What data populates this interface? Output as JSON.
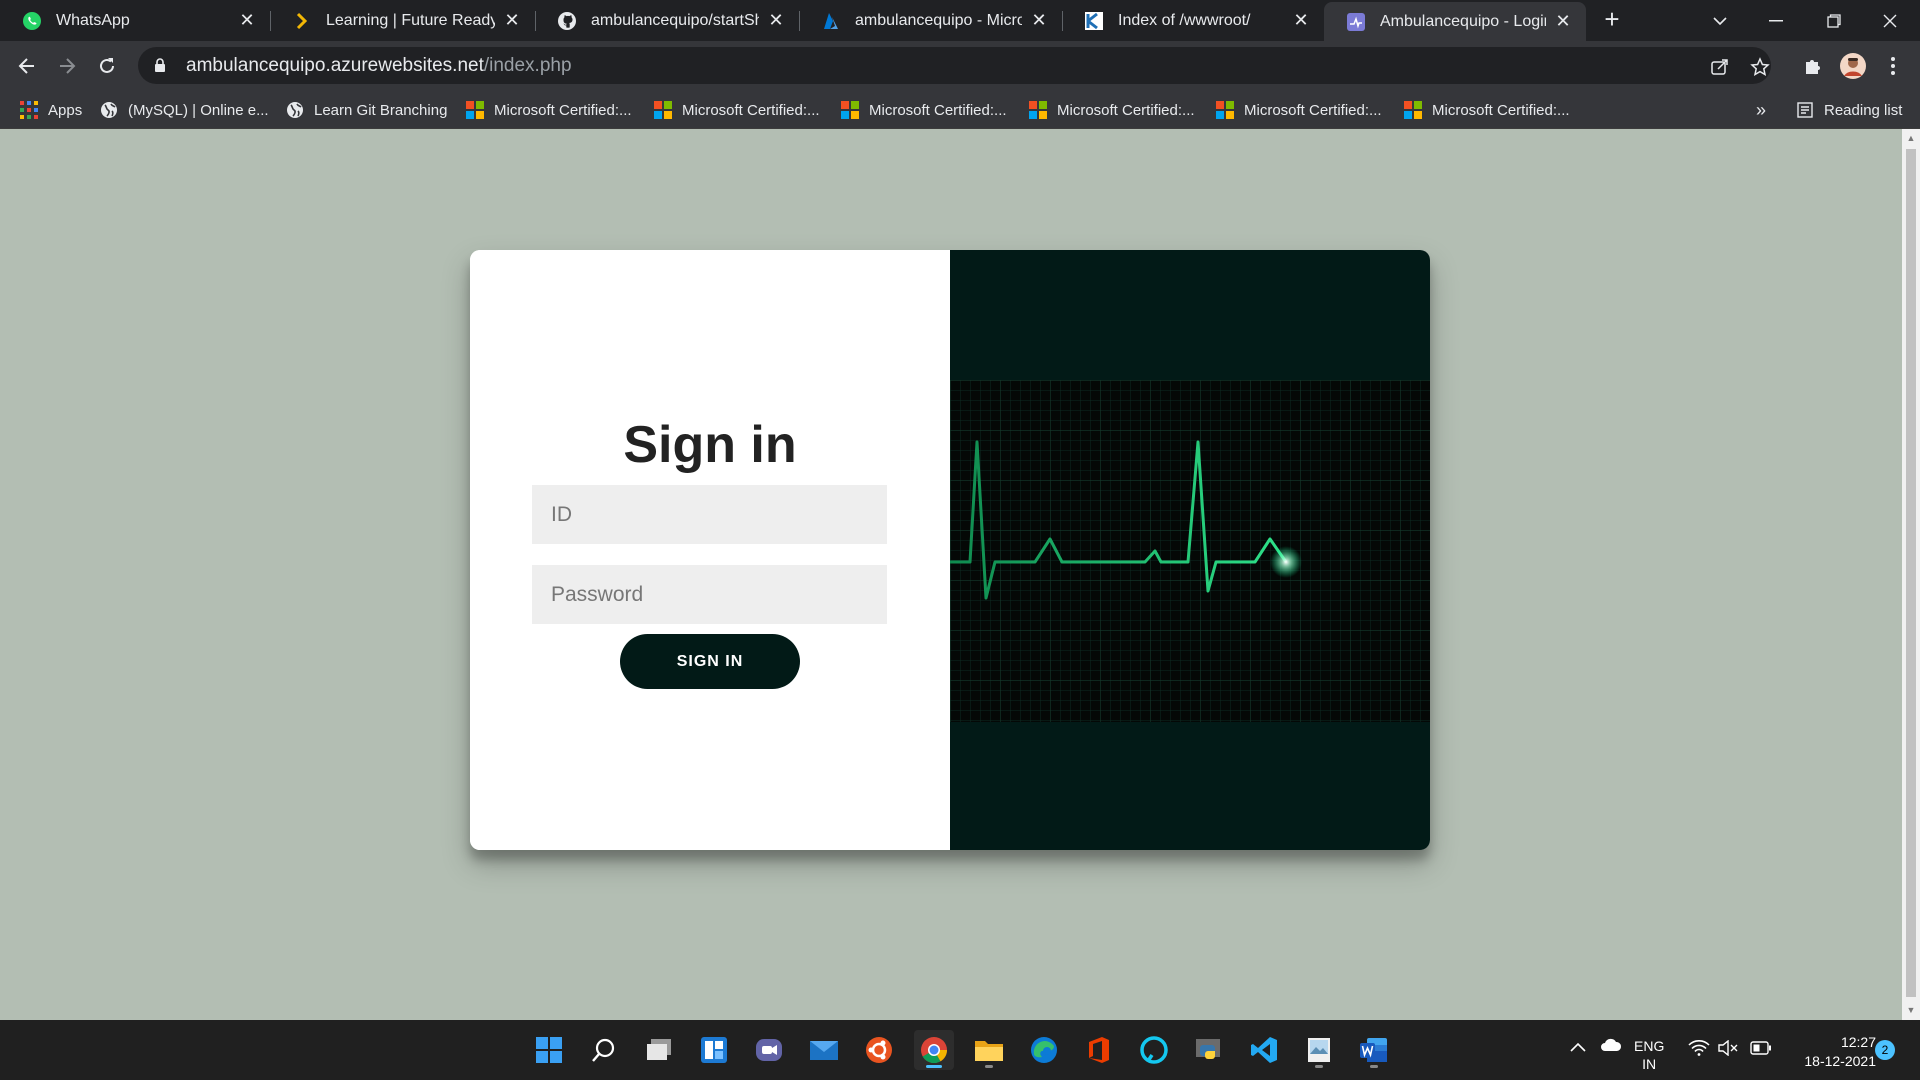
{
  "browser": {
    "tabs": [
      {
        "title": "WhatsApp",
        "icon": "whatsapp-icon"
      },
      {
        "title": "Learning | Future Ready Talent",
        "icon": "learning-icon"
      },
      {
        "title": "ambulancequipo/startSharing",
        "icon": "github-icon"
      },
      {
        "title": "ambulancequipo - Microsoft Azure",
        "icon": "azure-icon"
      },
      {
        "title": "Index of /wwwroot/",
        "icon": "kudu-icon"
      },
      {
        "title": "Ambulancequipo - Login",
        "icon": "site-icon",
        "active": true
      }
    ],
    "url": {
      "host": "ambulancequipo.azurewebsites.net",
      "path": "/index.php"
    },
    "bookmarks": [
      {
        "label": "Apps",
        "icon": "apps-grid-icon"
      },
      {
        "label": "(MySQL) | Online e...",
        "icon": "globe-icon"
      },
      {
        "label": "Learn Git Branching",
        "icon": "globe-icon"
      },
      {
        "label": "Microsoft Certified:...",
        "icon": "microsoft-logo-icon"
      },
      {
        "label": "Microsoft Certified:...",
        "icon": "microsoft-logo-icon"
      },
      {
        "label": "Microsoft Certified:...",
        "icon": "microsoft-logo-icon"
      },
      {
        "label": "Microsoft Certified:...",
        "icon": "microsoft-logo-icon"
      },
      {
        "label": "Microsoft Certified:...",
        "icon": "microsoft-logo-icon"
      },
      {
        "label": "Microsoft Certified:...",
        "icon": "microsoft-logo-icon"
      }
    ],
    "overflow_label": "»",
    "reading_list_label": "Reading list"
  },
  "login": {
    "heading": "Sign in",
    "id_placeholder": "ID",
    "password_placeholder": "Password",
    "submit_label": "SIGN IN",
    "accent_color": "#021a17"
  },
  "taskbar": {
    "apps": [
      "start-icon",
      "search-icon",
      "task-view-icon",
      "widgets-icon",
      "teams-chat-icon",
      "mail-icon",
      "ubuntu-icon",
      "chrome-icon",
      "file-explorer-icon",
      "edge-icon",
      "office-icon",
      "alexa-icon",
      "python-icon",
      "vscode-icon",
      "image-viewer-icon",
      "word-icon"
    ],
    "language_top": "ENG",
    "language_bottom": "IN",
    "time": "12:27",
    "date": "18-12-2021",
    "notification_count": "2"
  }
}
